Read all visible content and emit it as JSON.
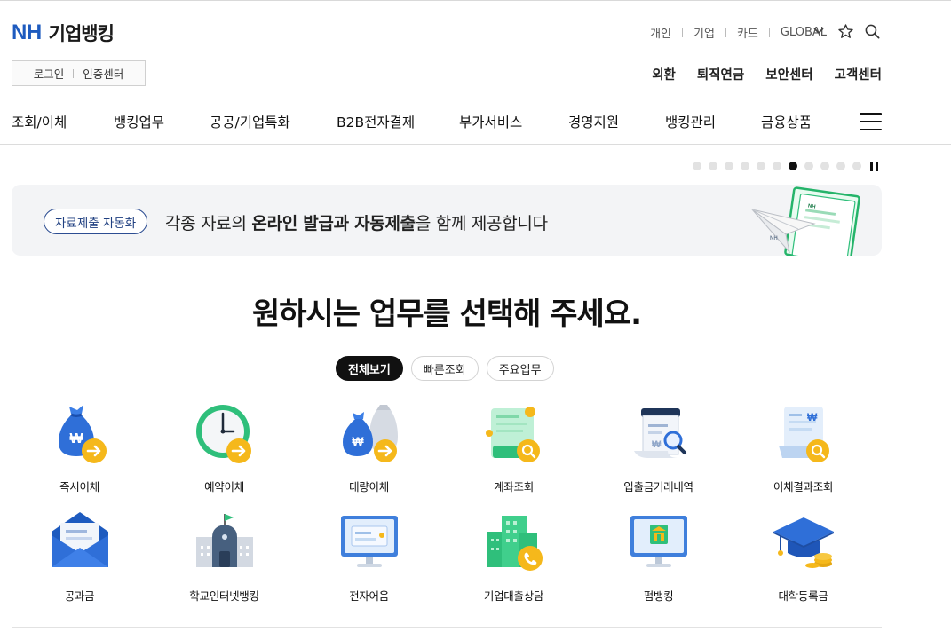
{
  "brand": {
    "mark": "NH",
    "name": "기업뱅킹",
    "color": "#1e5bbf"
  },
  "utility_nav": [
    "개인",
    "기업",
    "카드",
    "GLOBAL"
  ],
  "utility_icons": [
    "chevron-down-icon",
    "star-icon",
    "search-icon"
  ],
  "auth": {
    "login": "로그인",
    "cert_center": "인증센터"
  },
  "quick_links": [
    "외환",
    "퇴직연금",
    "보안센터",
    "고객센터"
  ],
  "gnb": [
    "조회/이체",
    "뱅킹업무",
    "공공/기업특화",
    "B2B전자결제",
    "부가서비스",
    "경영지원",
    "뱅킹관리",
    "금융상품"
  ],
  "carousel": {
    "total_slides": 11,
    "active_index": 6
  },
  "banner": {
    "pill": "자료제출 자동화",
    "text_parts": [
      "각종 자료의 ",
      "온라인 발급과 자동제출",
      "을 함께 제공합니다"
    ]
  },
  "main_title": "원하시는 업무를 선택해 주세요.",
  "filter_tabs": [
    "전체보기",
    "빠른조회",
    "주요업무"
  ],
  "services_row1": [
    "즉시이체",
    "예약이체",
    "대량이체",
    "계좌조회",
    "입출금거래내역",
    "이체결과조회"
  ],
  "services_row2": [
    "공과금",
    "학교인터넷뱅킹",
    "전자어음",
    "기업대출상담",
    "펌뱅킹",
    "대학등록금"
  ],
  "colors": {
    "accent_blue": "#2f6fd8",
    "accent_yellow": "#f5b81b",
    "accent_green": "#2fbf7b",
    "pill_border": "#2c4d92"
  }
}
